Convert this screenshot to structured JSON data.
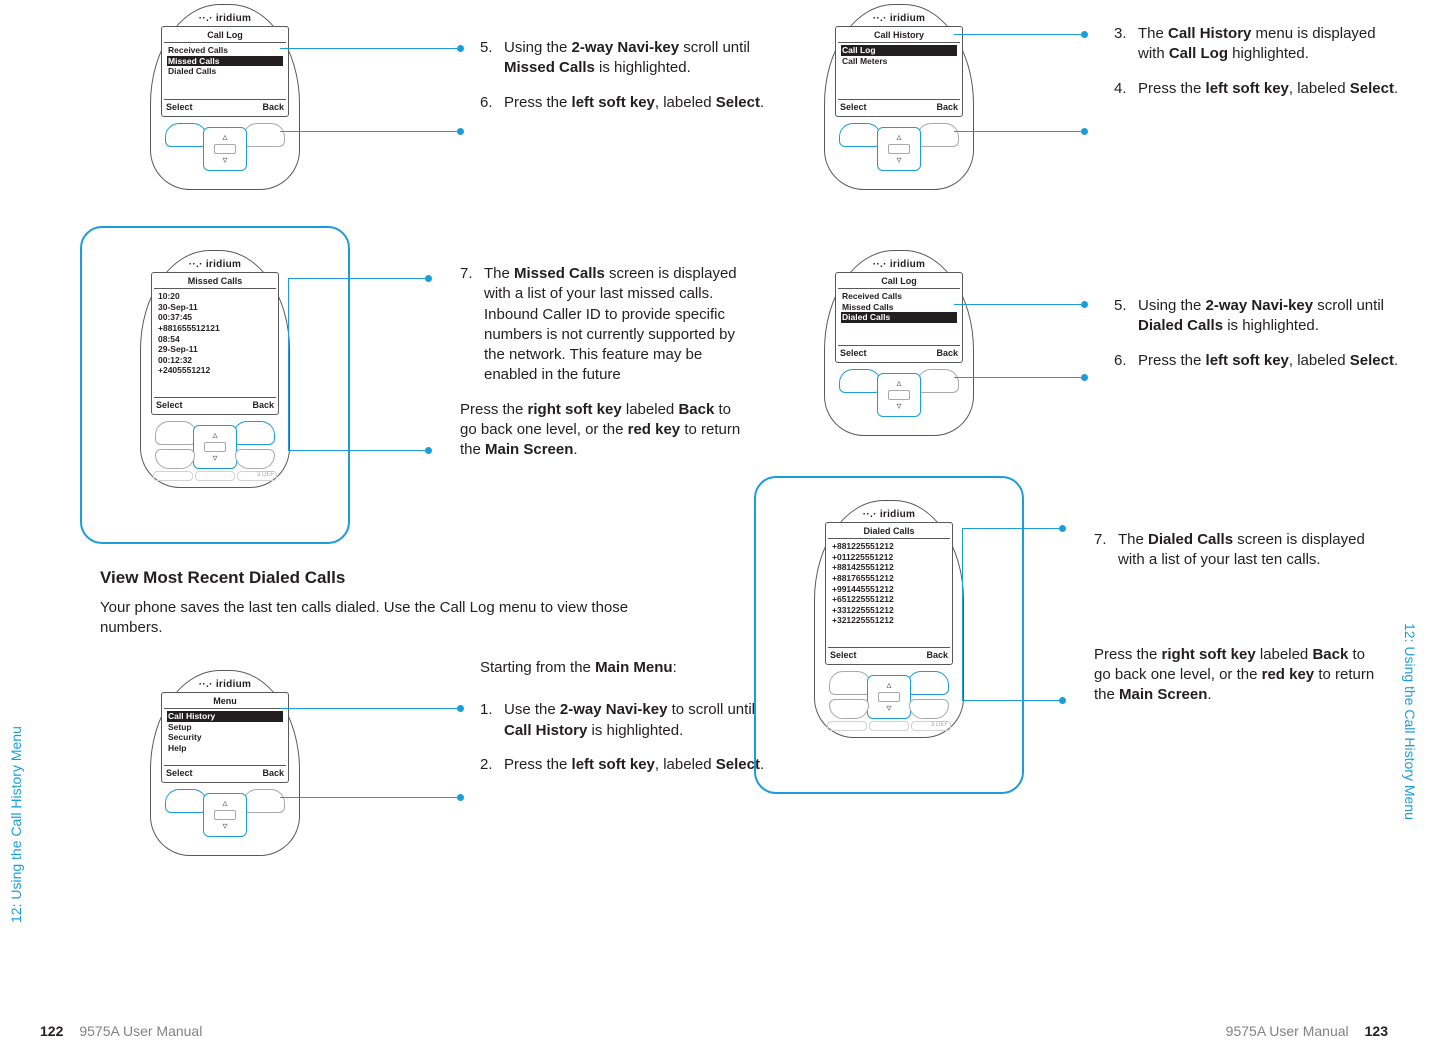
{
  "section_label": "12: Using the Call History Menu",
  "manual_name": "9575A User Manual",
  "page_left_num": "122",
  "page_right_num": "123",
  "brand": "iridium",
  "softkeys": {
    "select": "Select",
    "back": "Back"
  },
  "left": {
    "phone1": {
      "title": "Call Log",
      "items": [
        "Received Calls",
        "Missed Calls",
        "Dialed Calls"
      ],
      "highlight_index": 1
    },
    "steps1": [
      {
        "n": "5.",
        "html": "Using the <span class='b'>2-way Navi-key</span> scroll until <span class='b'>Missed Calls</span> is highlighted."
      },
      {
        "n": "6.",
        "html": "Press the <span class='b'>left soft key</span>, labeled <span class='b'>Select</span>."
      }
    ],
    "phone2": {
      "title": "Missed Calls",
      "lines": [
        "10:20",
        "30-Sep-11",
        "00:37:45",
        "+881655512121",
        "08:54",
        "29-Sep-11",
        "00:12:32",
        "+2405551212"
      ]
    },
    "steps2": [
      {
        "n": "7.",
        "html": "The <span class='b'>Missed Calls</span> screen is displayed with a list of your last missed calls. Inbound Caller ID to provide specific numbers is not currently supported by the network. This feature may be enabled in the future"
      }
    ],
    "aftertext2": "Press the <span class='b'>right soft key</span> labeled <span class='b'>Back</span> to go back one level, or the <span class='b'>red key</span> to return the <span class='b'>Main Screen</span>.",
    "section_heading": "View Most Recent Dialed Calls",
    "section_para": "Your phone saves the last ten calls dialed. Use the Call Log menu to view those numbers.",
    "starting": "Starting from the <span class='b'>Main Menu</span>:",
    "phone3": {
      "title": "Menu",
      "items": [
        "Call History",
        "Setup",
        "Security",
        "Help"
      ],
      "highlight_index": 0
    },
    "steps3": [
      {
        "n": "1.",
        "html": "Use the <span class='b'>2-way Navi-key</span> to scroll until <span class='b'>Call History</span> is highlighted."
      },
      {
        "n": "2.",
        "html": "Press the <span class='b'>left soft key</span>, labeled <span class='b'>Select</span>."
      }
    ]
  },
  "right": {
    "phone1": {
      "title": "Call History",
      "items": [
        "Call Log",
        "Call Meters"
      ],
      "highlight_index": 0
    },
    "steps1": [
      {
        "n": "3.",
        "html": "The <span class='b'>Call History</span> menu is displayed with <span class='b'>Call Log</span> highlighted."
      },
      {
        "n": "4.",
        "html": "Press the <span class='b'>left soft key</span>, labeled <span class='b'>Select</span>."
      }
    ],
    "phone2": {
      "title": "Call Log",
      "items": [
        "Received Calls",
        "Missed Calls",
        "Dialed Calls"
      ],
      "highlight_index": 2
    },
    "steps2": [
      {
        "n": "5.",
        "html": "Using the <span class='b'>2-way Navi-key</span> scroll until <span class='b'>Dialed Calls</span> is highlighted."
      },
      {
        "n": "6.",
        "html": "Press the <span class='b'>left soft key</span>, labeled <span class='b'>Select</span>."
      }
    ],
    "phone3": {
      "title": "Dialed Calls",
      "lines": [
        "+881225551212",
        "+011225551212",
        "+881425551212",
        "+881765551212",
        "+991445551212",
        "+651225551212",
        "+331225551212",
        "+321225551212"
      ]
    },
    "steps3": [
      {
        "n": "7.",
        "html": "The <span class='b'>Dialed Calls</span> screen is displayed with a list of your last ten calls."
      }
    ],
    "aftertext3": "Press the <span class='b'>right soft key</span> labeled <span class='b'>Back</span> to go back one level, or the <span class='b'>red key</span> to return the <span class='b'>Main Screen</span>."
  }
}
